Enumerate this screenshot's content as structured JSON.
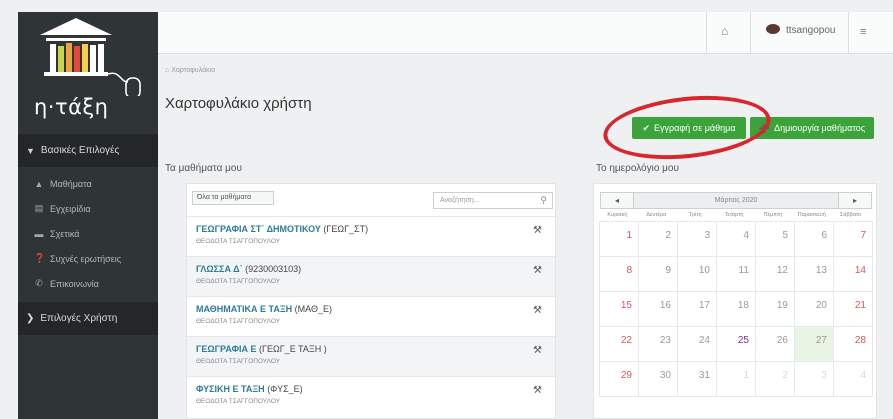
{
  "sidebar": {
    "logo_text": "η·τάξη",
    "section_main": "Βασικές Επιλογές",
    "items": [
      {
        "label": "Μαθήματα",
        "icon": "graduation-cap-icon"
      },
      {
        "label": "Εγχειρίδια",
        "icon": "document-icon"
      },
      {
        "label": "Σχετικά",
        "icon": "credit-card-icon"
      },
      {
        "label": "Συχνές ερωτήσεις",
        "icon": "question-icon"
      },
      {
        "label": "Επικοινωνία",
        "icon": "phone-icon"
      }
    ],
    "section_user": "Επιλογές Χρήστη"
  },
  "topbar": {
    "home_icon": "home-icon",
    "username": "ttsangopou",
    "menu_icon": "sliders-icon"
  },
  "breadcrumb": "Χαρτοφυλάκιο",
  "page_title": "Χαρτοφυλάκιο χρήστη",
  "buttons": {
    "enroll": "Εγγραφή σε μάθημα",
    "create": "Δημιουργία μαθήματος"
  },
  "courses": {
    "title": "Τα μαθήματα μου",
    "filter_label": "Όλα τα μαθήματα",
    "search_placeholder": "Αναζήτηση...",
    "list": [
      {
        "name": "ΓΕΩΓΡΑΦΙΑ ΣΤ΄ ΔΗΜΟΤΙΚΟΥ",
        "code": "(ΓΕΩΓ_ΣΤ)",
        "teacher": "ΘΕΟΔΟΤΑ ΤΣΑΓΓΟΠΟΥΛΟΥ"
      },
      {
        "name": "ΓΛΩΣΣΑ Δ΄",
        "code": "(9230003103)",
        "teacher": "ΘΕΟΔΟΤΑ ΤΣΑΓΓΟΠΟΥΛΟΥ"
      },
      {
        "name": "ΜΑΘΗΜΑΤΙΚΑ Ε ΤΑΞΗ",
        "code": "(ΜΑΘ_Ε)",
        "teacher": "ΘΕΟΔΟΤΑ ΤΣΑΓΓΟΠΟΥΛΟΥ"
      },
      {
        "name": "ΓΕΩΓΡΑΦΙΑ Ε",
        "code": "(ΓΕΩΓ_Ε ΤΑΞΗ )",
        "teacher": "ΘΕΟΔΟΤΑ ΤΣΑΓΓΟΠΟΥΛΟΥ"
      },
      {
        "name": "ΦΥΣΙΚΗ Ε ΤΑΞΗ",
        "code": "(ΦΥΣ_Ε)",
        "teacher": "ΘΕΟΔΟΤΑ ΤΣΑΓΓΟΠΟΥΛΟΥ"
      }
    ]
  },
  "calendar": {
    "title": "Το ημερολόγιο μου",
    "month": "Μάρτιος 2020",
    "prev": "◂",
    "next": "▸",
    "weekdays": [
      "Κυριακή",
      "Δευτέρα",
      "Τρίτη",
      "Τετάρτη",
      "Πέμπτη",
      "Παρασκευή",
      "Σάββατο"
    ],
    "weeks": [
      [
        "1",
        "2",
        "3",
        "4",
        "5",
        "6",
        "7"
      ],
      [
        "8",
        "9",
        "10",
        "11",
        "12",
        "13",
        "14"
      ],
      [
        "15",
        "16",
        "17",
        "18",
        "19",
        "20",
        "21"
      ],
      [
        "22",
        "23",
        "24",
        "25",
        "26",
        "27",
        "28"
      ],
      [
        "29",
        "30",
        "31",
        "1",
        "2",
        "3",
        "4"
      ]
    ],
    "today": "27",
    "highlighted": "25"
  }
}
